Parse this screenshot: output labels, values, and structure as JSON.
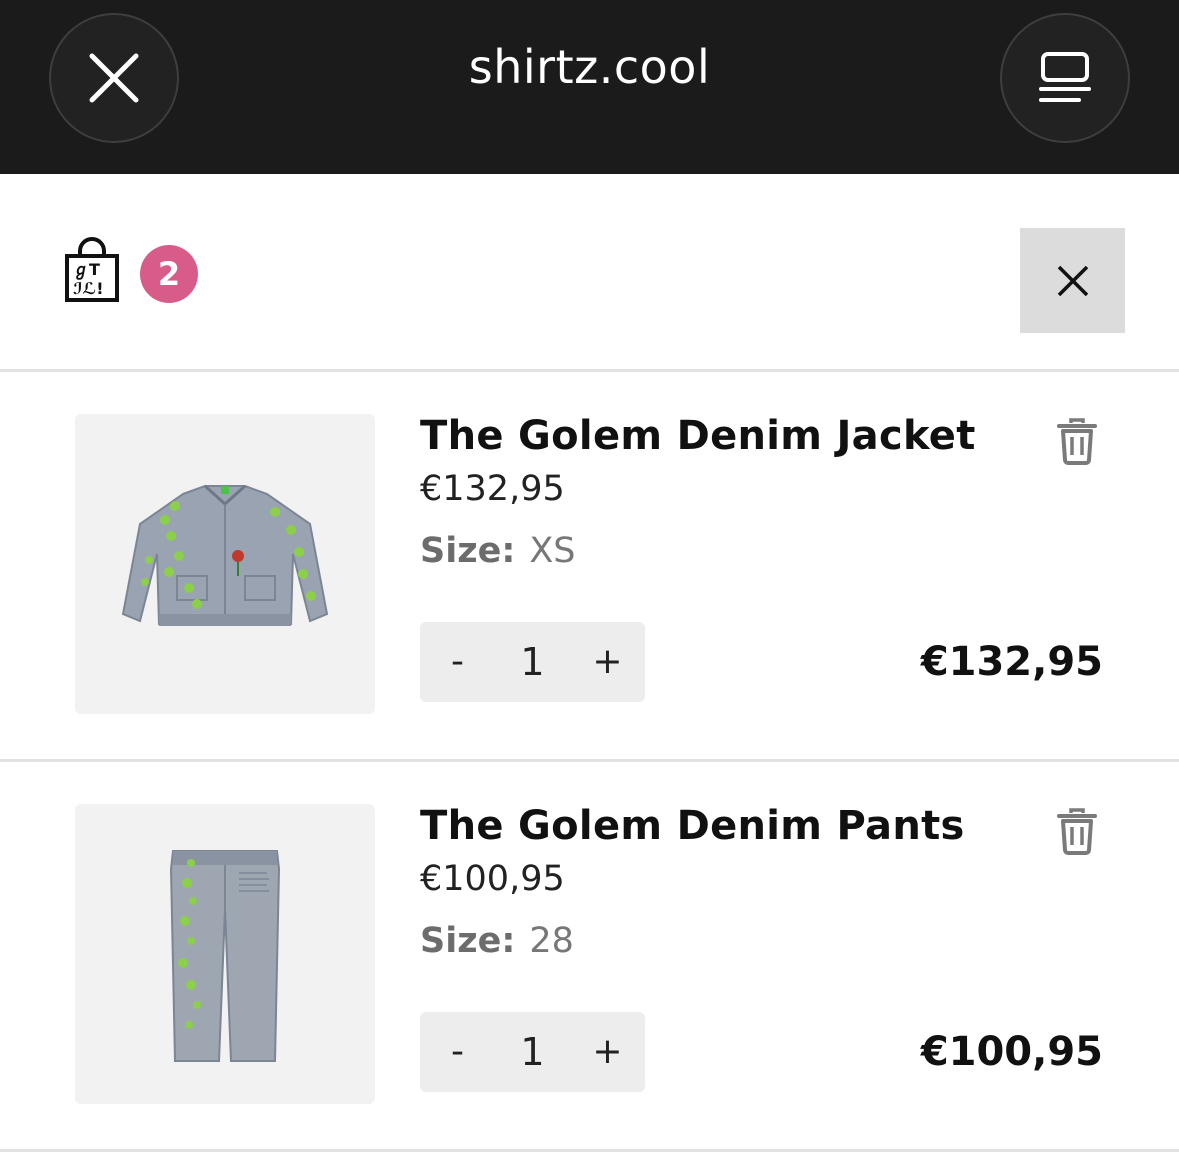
{
  "browser": {
    "site_title": "shirtz.cool",
    "close_icon": "close-icon",
    "tabs_icon": "tabs-icon"
  },
  "cart": {
    "item_count": "2",
    "bag_icon": "shopping-bag-icon",
    "close_icon": "close-icon",
    "badge_color": "#d85c8a"
  },
  "items": [
    {
      "title": "The Golem Denim Jacket",
      "price": "€132,95",
      "size_label": "Size:",
      "size_value": "XS",
      "qty_minus": "-",
      "quantity": "1",
      "qty_plus": "+",
      "line_total": "€132,95",
      "image": "denim-jacket-image",
      "delete_icon": "trash-icon"
    },
    {
      "title": "The Golem Denim Pants",
      "price": "€100,95",
      "size_label": "Size:",
      "size_value": "28",
      "qty_minus": "-",
      "quantity": "1",
      "qty_plus": "+",
      "line_total": "€100,95",
      "image": "denim-pants-image",
      "delete_icon": "trash-icon"
    }
  ]
}
